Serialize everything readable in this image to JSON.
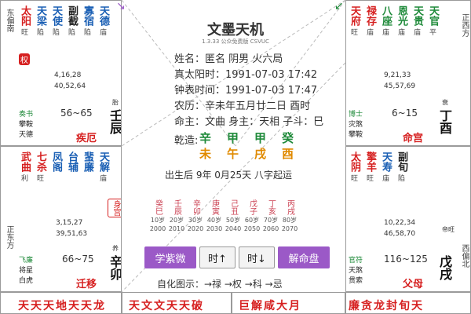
{
  "center": {
    "title": "文墨天机",
    "subtitle": "1.3.33 公众免费版  CSVUC",
    "lines": [
      "姓名：匿名    阴男 火六局",
      "真太阳时：1991-07-03  17:42",
      "钟表时间：1991-07-03  17:47",
      "农历：辛未年五月廿二日 酉时",
      "命主：文曲 身主：天相 子斗：巳"
    ],
    "bazi_label": "乾造:",
    "bazi_top": [
      "辛",
      "甲",
      "甲",
      "癸"
    ],
    "bazi_bottom": [
      "未",
      "午",
      "戌",
      "酉"
    ],
    "qiyun": "出生后 9年 0月25天 八字起运",
    "dayun": [
      {
        "g": "癸巳",
        "a": "10岁",
        "y": "2000"
      },
      {
        "g": "壬辰",
        "a": "20岁",
        "y": "2010"
      },
      {
        "g": "辛卯",
        "a": "30岁",
        "y": "2020"
      },
      {
        "g": "庚寅",
        "a": "40岁",
        "y": "2030"
      },
      {
        "g": "己丑",
        "a": "50岁",
        "y": "2040"
      },
      {
        "g": "戊子",
        "a": "60岁",
        "y": "2050"
      },
      {
        "g": "丁亥",
        "a": "70岁",
        "y": "2060"
      },
      {
        "g": "丙戌",
        "a": "80岁",
        "y": "2070"
      }
    ],
    "buttons": {
      "learn": "学紫微",
      "time_up": "时↑",
      "time_down": "时↓",
      "interpret": "解命盘"
    },
    "legend": "自化图示：→禄 →权 →科 →忌"
  },
  "palaces": {
    "p_tl": {
      "stars": [
        [
          "太阳",
          "旺",
          "red"
        ],
        [
          "天梁",
          "陷",
          "blue"
        ],
        [
          "天使",
          "陷",
          "blue"
        ],
        [
          "副截",
          "陷",
          "black"
        ],
        [
          "寡宿",
          "陷",
          "blue"
        ],
        [
          "天德",
          "庙",
          "blue"
        ]
      ],
      "badge": "权",
      "nums1": "4,16,28",
      "nums2": "40,52,64",
      "minors": [
        "奏书",
        "攀鞍",
        "天德"
      ],
      "range": "56~65",
      "stage": "胎",
      "ganzhi": "壬辰",
      "name": "疾厄"
    },
    "p_tr": {
      "stars": [
        [
          "天府",
          "旺",
          "red"
        ],
        [
          "禄存",
          "庙",
          "red"
        ],
        [
          "八座",
          "庙",
          "green"
        ],
        [
          "恩光",
          "庙",
          "green"
        ],
        [
          "天贵",
          "庙",
          "green"
        ],
        [
          "天官",
          "平",
          "green"
        ]
      ],
      "nums1": "9,21,33",
      "nums2": "45,57,69",
      "minors": [
        "博士",
        "灾煞",
        "攀鞍"
      ],
      "range": "6~15",
      "stage": "衰",
      "ganzhi": "丁酉",
      "name": "命宫"
    },
    "p_ml": {
      "stars": [
        [
          "武曲",
          "利",
          "red"
        ],
        [
          "七杀",
          "旺",
          "red"
        ],
        [
          "凤阁",
          "",
          "blue"
        ],
        [
          "台辅",
          "",
          "blue"
        ],
        [
          "蜚廉",
          "",
          "blue"
        ],
        [
          "天解",
          "庙",
          "blue"
        ]
      ],
      "badge2": "身宫",
      "nums1": "3,15,27",
      "nums2": "39,51,63",
      "minors": [
        "飞廉",
        "将星",
        "白虎"
      ],
      "range": "66~75",
      "stage": "养",
      "ganzhi": "辛卯",
      "name": "迁移"
    },
    "p_mr": {
      "stars": [
        [
          "太阴",
          "旺",
          "red"
        ],
        [
          "擎羊",
          "旺",
          "red"
        ],
        [
          "天寿",
          "庙",
          "blue"
        ],
        [
          "副旬",
          "陷",
          "black"
        ]
      ],
      "nums1": "10,22,34",
      "nums2": "46,58,70",
      "minors": [
        "官符",
        "天煞",
        "贯索"
      ],
      "range": "116~125",
      "stage": "帝旺",
      "ganzhi": "戊戌",
      "name": "父母"
    },
    "bottom_row": [
      "天天天地天天龙",
      "天文文天天破",
      "巨解咸大月",
      "廉贪龙封旬天"
    ]
  },
  "sides": {
    "left_top": "东偏南",
    "left_mid": "正东方",
    "right_top": "正西方",
    "right_mid": "西偏北"
  },
  "colors": {
    "red": "#d62020",
    "blue": "#1a5fb4",
    "purple": "#9b59c7",
    "green": "#1f8a3a"
  }
}
